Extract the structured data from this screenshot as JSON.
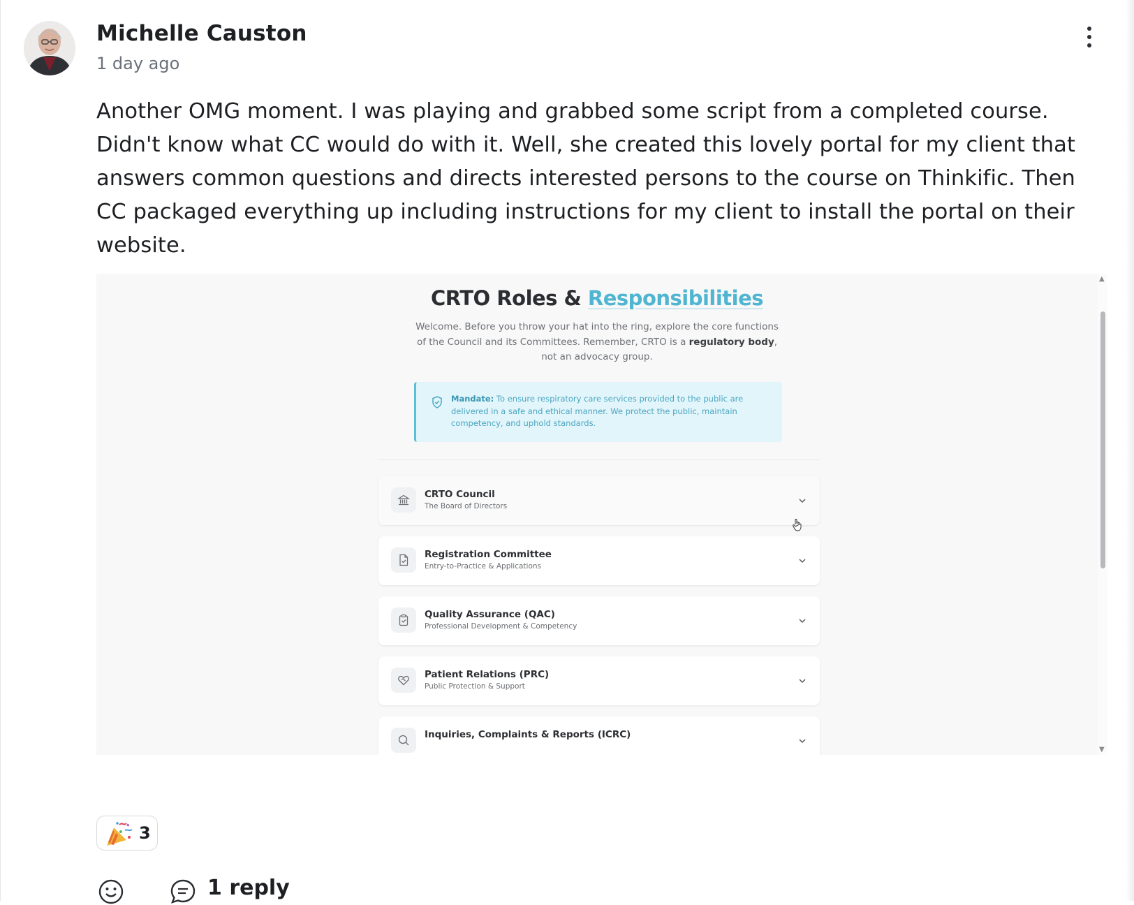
{
  "post": {
    "author": "Michelle Causton",
    "timestamp": "1 day ago",
    "body": "Another OMG moment. I was playing and grabbed some script from a completed course. Didn't know what CC would do with it. Well, she created this lovely portal for my client that answers common questions and directs interested persons to the course on Thinkific. Then CC packaged everything up including instructions for my client to install the portal on their website."
  },
  "embed": {
    "title_part1": "CRTO Roles & ",
    "title_part2": "Responsibilities",
    "intro_1": "Welcome. Before you throw your hat into the ring, explore the core functions of the Council and its Committees. Remember, CRTO is a ",
    "intro_bold": "regulatory body",
    "intro_2": ", not an advocacy group.",
    "mandate_label": "Mandate:",
    "mandate_text": " To ensure respiratory care services provided to the public are delivered in a safe and ethical manner. We protect the public, maintain competency, and uphold standards.",
    "accordions": [
      {
        "title": "CRTO Council",
        "subtitle": "The Board of Directors",
        "icon": "bank-icon"
      },
      {
        "title": "Registration Committee",
        "subtitle": "Entry-to-Practice & Applications",
        "icon": "file-check-icon"
      },
      {
        "title": "Quality Assurance (QAC)",
        "subtitle": "Professional Development & Competency",
        "icon": "clipboard-check-icon"
      },
      {
        "title": "Patient Relations (PRC)",
        "subtitle": "Public Protection & Support",
        "icon": "heart-handshake-icon"
      },
      {
        "title": "Inquiries, Complaints & Reports (ICRC)",
        "subtitle": "",
        "icon": "search-icon"
      }
    ]
  },
  "reactions": {
    "emoji": "party-popper-icon",
    "count": "3"
  },
  "actions": {
    "reply_label": "1 reply"
  },
  "colors": {
    "accent": "#4fb5d0",
    "mandate_bg": "#e2f5fb",
    "text": "#1d1f22",
    "muted": "#6a7079"
  }
}
